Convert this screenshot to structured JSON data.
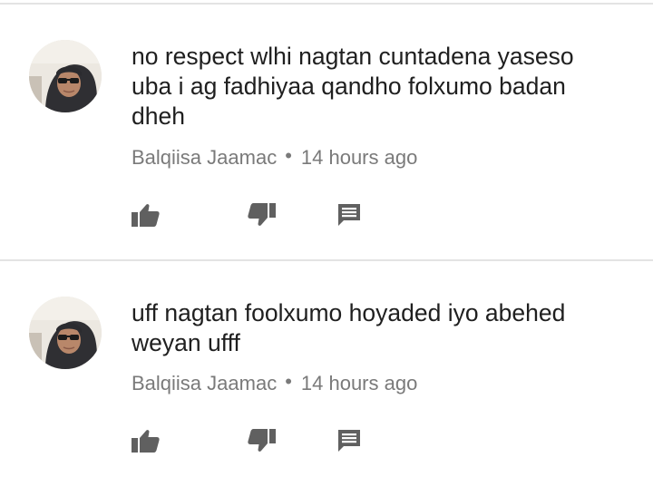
{
  "comments": [
    {
      "text": "no respect wlhi nagtan cuntadena yaseso\nuba i ag fadhiyaa qandho folxumo badan\ndheh",
      "author": "Balqiisa Jaamac",
      "separator": "•",
      "time": "14 hours ago"
    },
    {
      "text": "uff nagtan foolxumo hoyaded iyo abehed\nweyan ufff",
      "author": "Balqiisa Jaamac",
      "separator": "•",
      "time": "14 hours ago"
    }
  ],
  "icons": {
    "like": "thumb-up-icon",
    "dislike": "thumb-down-icon",
    "reply": "comment-icon"
  },
  "colors": {
    "text": "#1f1f1f",
    "meta": "#7a7a7a",
    "icon": "#606060",
    "divider": "#e3e3e3"
  }
}
